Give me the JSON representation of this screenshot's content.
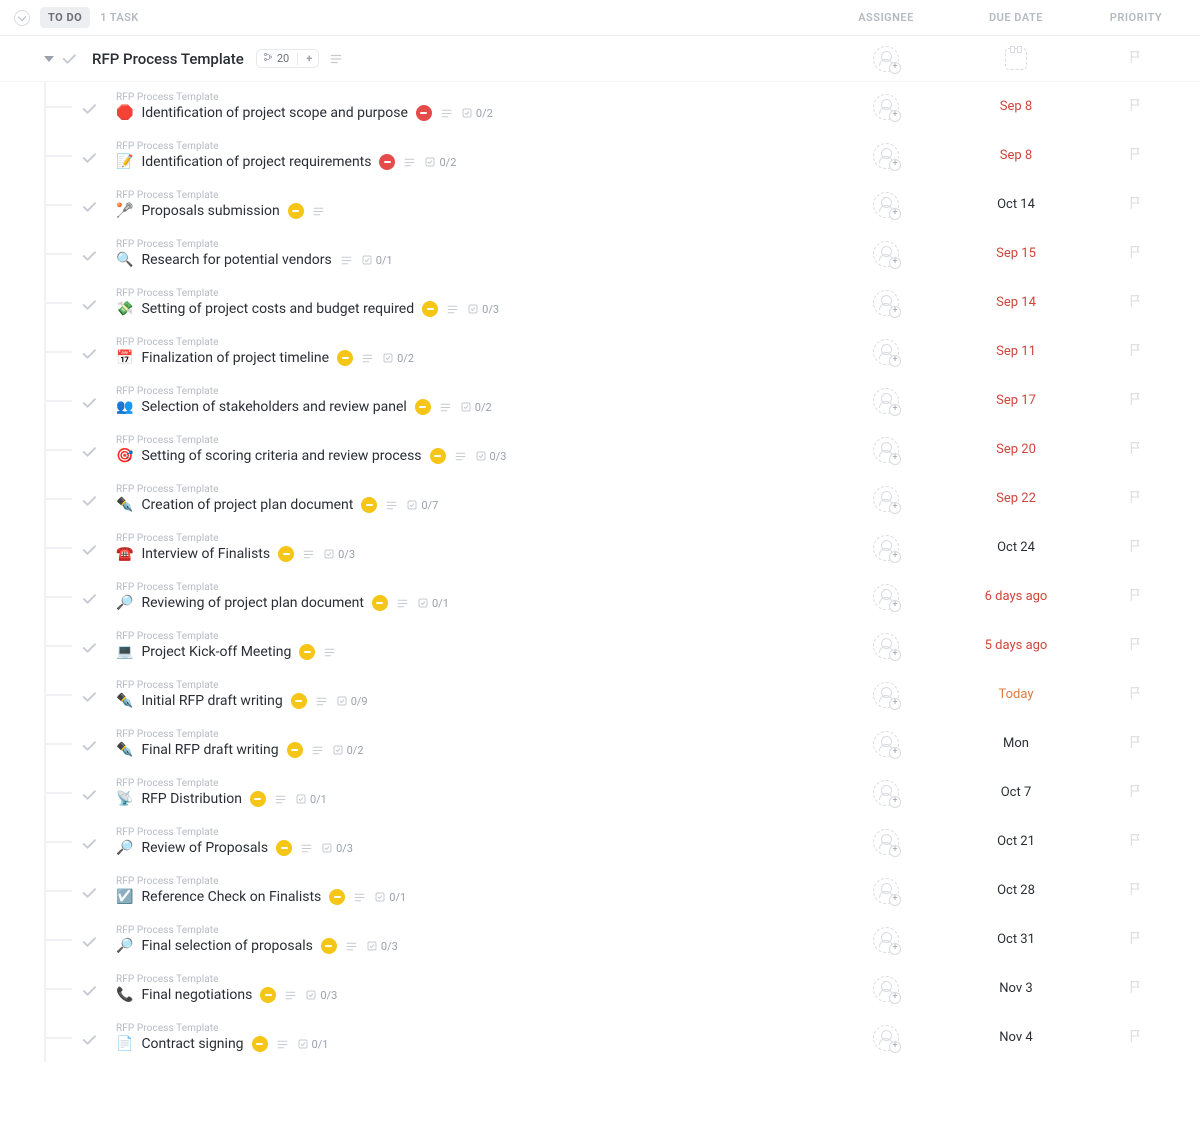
{
  "header": {
    "status_label": "TO DO",
    "task_count_label": "1 TASK",
    "columns": {
      "assignee": "ASSIGNEE",
      "due": "DUE DATE",
      "priority": "PRIORITY"
    }
  },
  "parent": {
    "title": "RFP Process Template",
    "subtask_count": "20"
  },
  "breadcrumb": "RFP Process Template",
  "tasks": [
    {
      "emoji": "🛑",
      "title": "Identification of project scope and purpose",
      "status": "red",
      "has_desc": true,
      "subtasks": "0/2",
      "due": "Sep 8",
      "due_style": "overdue"
    },
    {
      "emoji": "📝",
      "title": "Identification of project requirements",
      "status": "red",
      "has_desc": true,
      "subtasks": "0/2",
      "due": "Sep 8",
      "due_style": "overdue"
    },
    {
      "emoji": "🥍",
      "title": "Proposals submission",
      "status": "amber",
      "has_desc": true,
      "subtasks": "",
      "due": "Oct 14",
      "due_style": "normal"
    },
    {
      "emoji": "🔍",
      "title": "Research for potential vendors",
      "status": "",
      "has_desc": true,
      "subtasks": "0/1",
      "due": "Sep 15",
      "due_style": "overdue"
    },
    {
      "emoji": "💸",
      "title": "Setting of project costs and budget required",
      "status": "amber",
      "has_desc": true,
      "subtasks": "0/3",
      "due": "Sep 14",
      "due_style": "overdue"
    },
    {
      "emoji": "📅",
      "title": "Finalization of project timeline",
      "status": "amber",
      "has_desc": true,
      "subtasks": "0/2",
      "due": "Sep 11",
      "due_style": "overdue"
    },
    {
      "emoji": "👥",
      "title": "Selection of stakeholders and review panel",
      "status": "amber",
      "has_desc": true,
      "subtasks": "0/2",
      "due": "Sep 17",
      "due_style": "overdue"
    },
    {
      "emoji": "🎯",
      "title": "Setting of scoring criteria and review process",
      "status": "amber",
      "has_desc": true,
      "subtasks": "0/3",
      "due": "Sep 20",
      "due_style": "overdue"
    },
    {
      "emoji": "✒️",
      "title": "Creation of project plan document",
      "status": "amber",
      "has_desc": true,
      "subtasks": "0/7",
      "due": "Sep 22",
      "due_style": "overdue"
    },
    {
      "emoji": "☎️",
      "title": "Interview of Finalists",
      "status": "amber",
      "has_desc": true,
      "subtasks": "0/3",
      "due": "Oct 24",
      "due_style": "normal"
    },
    {
      "emoji": "🔎",
      "title": "Reviewing of project plan document",
      "status": "amber",
      "has_desc": true,
      "subtasks": "0/1",
      "due": "6 days ago",
      "due_style": "overdue"
    },
    {
      "emoji": "💻",
      "title": "Project Kick-off Meeting",
      "status": "amber",
      "has_desc": true,
      "subtasks": "",
      "due": "5 days ago",
      "due_style": "overdue"
    },
    {
      "emoji": "✒️",
      "title": "Initial RFP draft writing",
      "status": "amber",
      "has_desc": true,
      "subtasks": "0/9",
      "due": "Today",
      "due_style": "today"
    },
    {
      "emoji": "✒️",
      "title": "Final RFP draft writing",
      "status": "amber",
      "has_desc": true,
      "subtasks": "0/2",
      "due": "Mon",
      "due_style": "normal"
    },
    {
      "emoji": "📡",
      "title": "RFP Distribution",
      "status": "amber",
      "has_desc": true,
      "subtasks": "0/1",
      "due": "Oct 7",
      "due_style": "normal"
    },
    {
      "emoji": "🔎",
      "title": "Review of Proposals",
      "status": "amber",
      "has_desc": true,
      "subtasks": "0/3",
      "due": "Oct 21",
      "due_style": "normal"
    },
    {
      "emoji": "☑️",
      "title": "Reference Check on Finalists",
      "status": "amber",
      "has_desc": true,
      "subtasks": "0/1",
      "due": "Oct 28",
      "due_style": "normal"
    },
    {
      "emoji": "🔎",
      "title": "Final selection of proposals",
      "status": "amber",
      "has_desc": true,
      "subtasks": "0/3",
      "due": "Oct 31",
      "due_style": "normal"
    },
    {
      "emoji": "📞",
      "title": "Final negotiations",
      "status": "amber",
      "has_desc": true,
      "subtasks": "0/3",
      "due": "Nov 3",
      "due_style": "normal"
    },
    {
      "emoji": "📄",
      "title": "Contract signing",
      "status": "amber",
      "has_desc": true,
      "subtasks": "0/1",
      "due": "Nov 4",
      "due_style": "normal"
    }
  ]
}
